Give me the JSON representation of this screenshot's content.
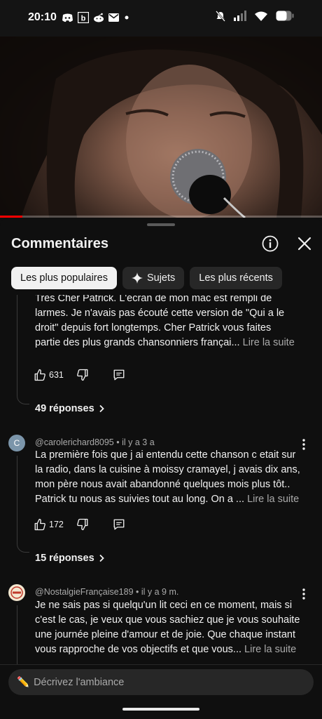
{
  "status_bar": {
    "time": "20:10",
    "left_icons": [
      "discord-icon",
      "bandcamp-icon",
      "reddit-icon",
      "mail-icon",
      "dot-icon"
    ],
    "right_icons": [
      "mute-icon",
      "signal-icon",
      "wifi-icon",
      "battery-icon"
    ]
  },
  "video": {
    "progress": 0.07
  },
  "sheet": {
    "title": "Commentaires",
    "chips": [
      {
        "label": "Les plus populaires",
        "selected": true
      },
      {
        "label": "Sujets",
        "icon": "sparkle-icon",
        "selected": false
      },
      {
        "label": "Les plus récents",
        "selected": false
      }
    ]
  },
  "comments": [
    {
      "lines": [
        "Très Cher Patrick. L'écran de mon mac est rempli de",
        "larmes.  Je n'avais pas écouté cette version  de \"Qui a le",
        "droit\" depuis fort longtemps. Cher Patrick  vous faites",
        "partie des plus grands chansonniers françai..."
      ],
      "read_more": "Lire la suite",
      "likes": "631",
      "replies": "49 réponses"
    },
    {
      "author": "@carolerichard8095",
      "time": "il y a 3 a",
      "avatar_letter": "C",
      "lines": [
        "La première fois que j ai entendu cette chanson c etait sur",
        "la radio, dans la cuisine à moissy cramayel, j avais dix ans,",
        "mon père nous avait abandonné quelques mois plus tôt..",
        "Patrick tu nous as suivies tout au long. On a ..."
      ],
      "read_more": "Lire la suite",
      "likes": "172",
      "replies": "15 réponses"
    },
    {
      "author": "@NostalgieFrançaise189",
      "time": "il y a 9 m.",
      "lines": [
        "Je ne sais pas si quelqu'un lit ceci en ce moment, mais si",
        "c'est le cas, je veux que vous sachiez que je vous souhaite",
        "une journée pleine d'amour et de joie. Que chaque instant",
        "vous rapproche de vos objectifs et que vous..."
      ],
      "read_more": "Lire la suite"
    }
  ],
  "composer": {
    "placeholder": "Décrivez l'ambiance",
    "emoji": "✏️"
  },
  "colors": {
    "background": "#0f0f0f",
    "chip": "#272727",
    "chip_selected": "#f1f1f1",
    "secondary_text": "#aaaaaa",
    "progress": "#ff0000"
  }
}
